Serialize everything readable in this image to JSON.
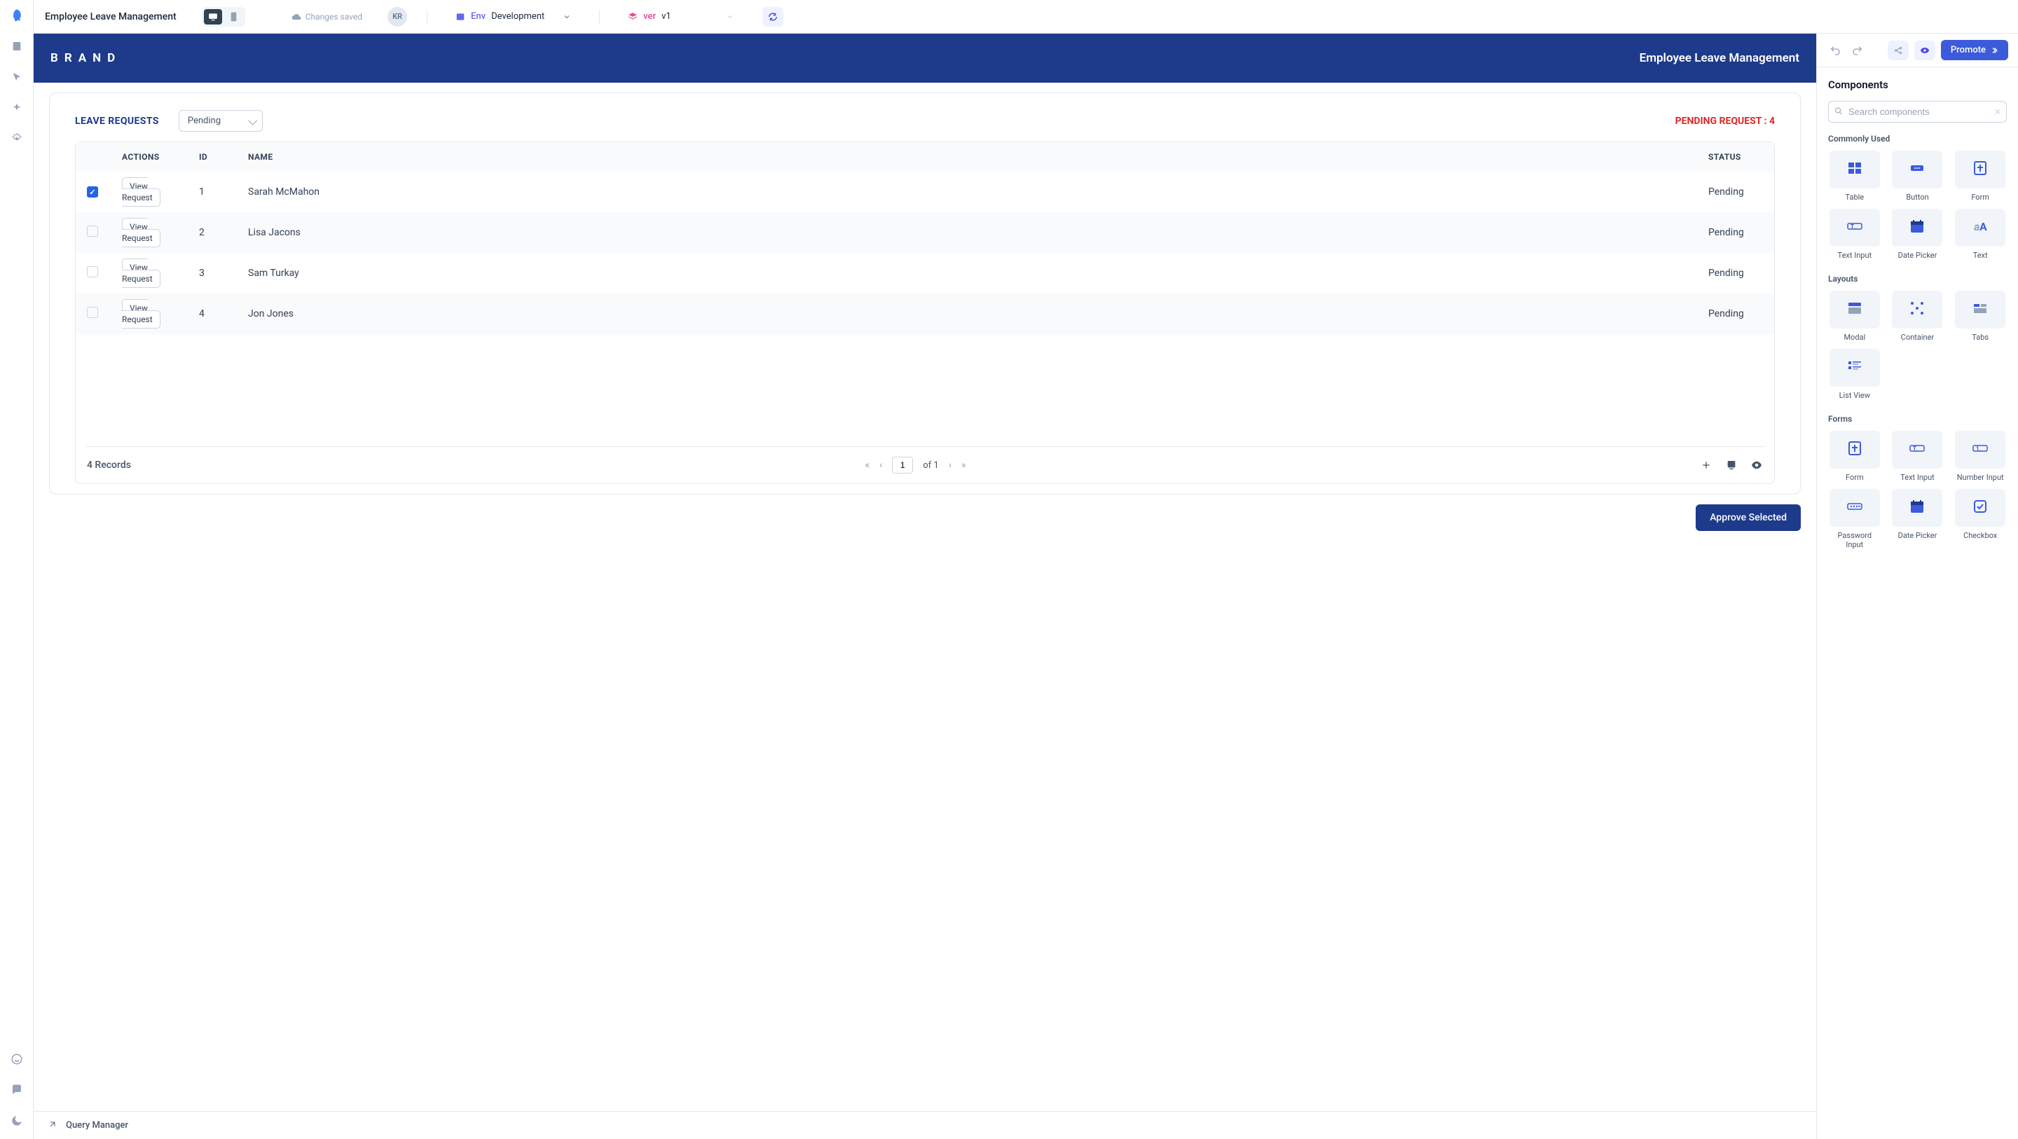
{
  "header": {
    "app_title": "Employee Leave Management",
    "saved_text": "Changes saved",
    "user_initials": "KR",
    "env_label": "Env",
    "env_value": "Development",
    "ver_label": "ver",
    "ver_value": "v1",
    "promote": "Promote"
  },
  "brand": {
    "logo": "BRAND",
    "title": "Employee Leave Management"
  },
  "card": {
    "title": "LEAVE REQUESTS",
    "filter_value": "Pending",
    "pending_label": "PENDING REQUEST : 4"
  },
  "table": {
    "headers": {
      "actions": "ACTIONS",
      "id": "ID",
      "name": "NAME",
      "status": "STATUS"
    },
    "view_label": "View Request",
    "rows": [
      {
        "checked": true,
        "id": "1",
        "name": "Sarah McMahon",
        "status": "Pending"
      },
      {
        "checked": false,
        "id": "2",
        "name": "Lisa Jacons",
        "status": "Pending"
      },
      {
        "checked": false,
        "id": "3",
        "name": "Sam Turkay",
        "status": "Pending"
      },
      {
        "checked": false,
        "id": "4",
        "name": "Jon Jones",
        "status": "Pending"
      }
    ],
    "footer": {
      "records": "4 Records",
      "page_current": "1",
      "page_of": "of 1"
    }
  },
  "approve_label": "Approve Selected",
  "query_manager": "Query Manager",
  "components": {
    "title": "Components",
    "search_placeholder": "Search components",
    "sections": {
      "common": "Commonly Used",
      "layouts": "Layouts",
      "forms": "Forms"
    },
    "common": [
      "Table",
      "Button",
      "Form",
      "Text Input",
      "Date Picker",
      "Text"
    ],
    "layouts": [
      "Modal",
      "Container",
      "Tabs",
      "List View"
    ],
    "forms": [
      "Form",
      "Text Input",
      "Number Input",
      "Password Input",
      "Date Picker",
      "Checkbox"
    ]
  }
}
